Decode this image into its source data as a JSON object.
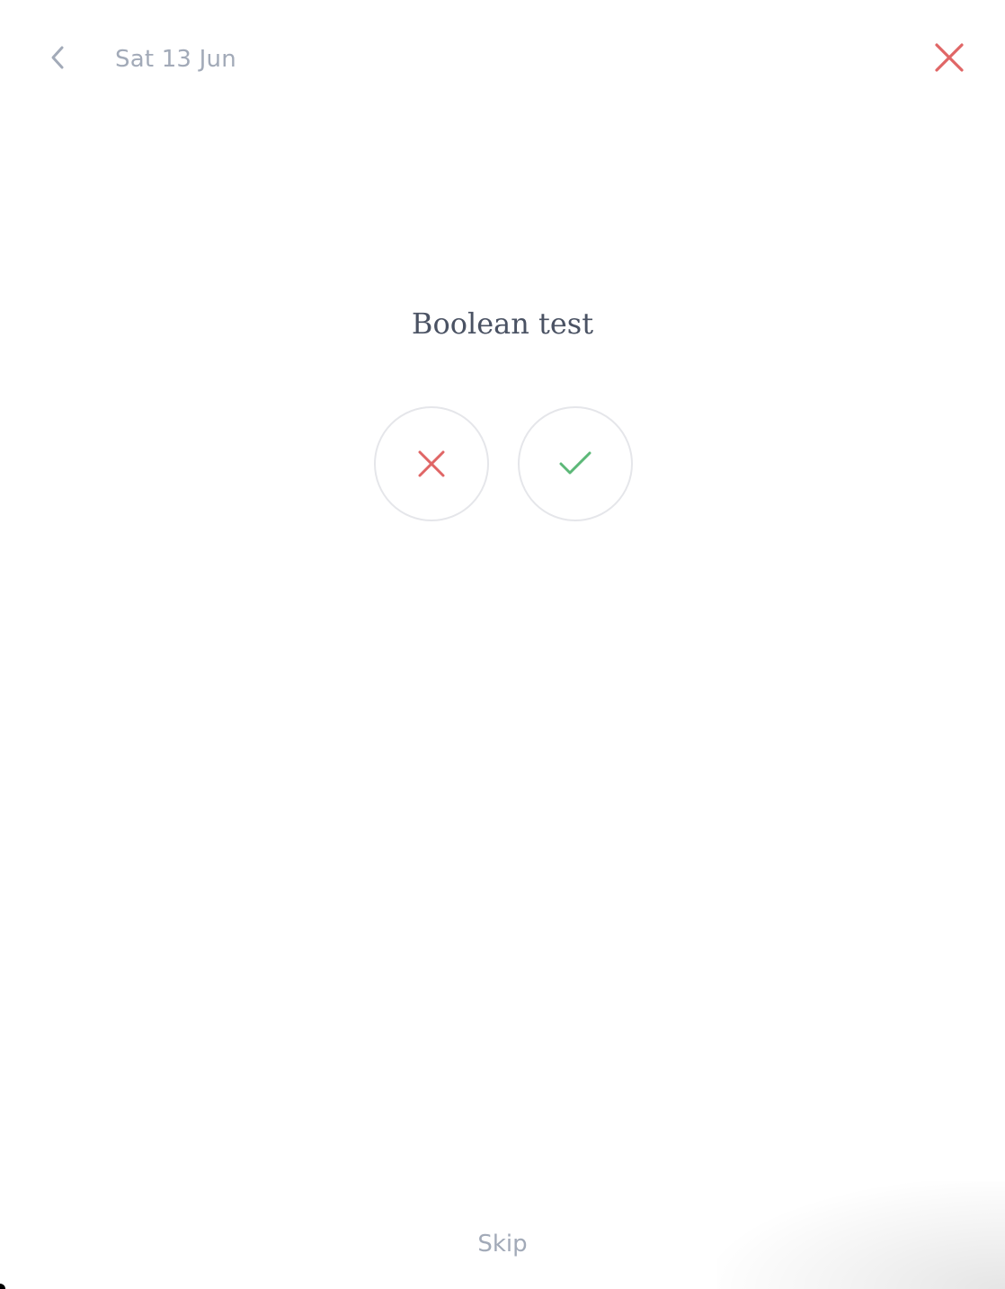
{
  "header": {
    "back_icon": "chevron-left-icon",
    "date": "Sat 13 Jun",
    "close_icon": "close-icon",
    "close_color": "#e06666"
  },
  "question": {
    "title": "Boolean test"
  },
  "answers": {
    "no_icon": "cross-icon",
    "no_color": "#e06666",
    "yes_icon": "check-icon",
    "yes_color": "#5cb878"
  },
  "footer": {
    "skip_label": "Skip"
  },
  "colors": {
    "muted_text": "#a2aab8",
    "title_text": "#4a5263",
    "circle_border": "#e5e6ea"
  }
}
